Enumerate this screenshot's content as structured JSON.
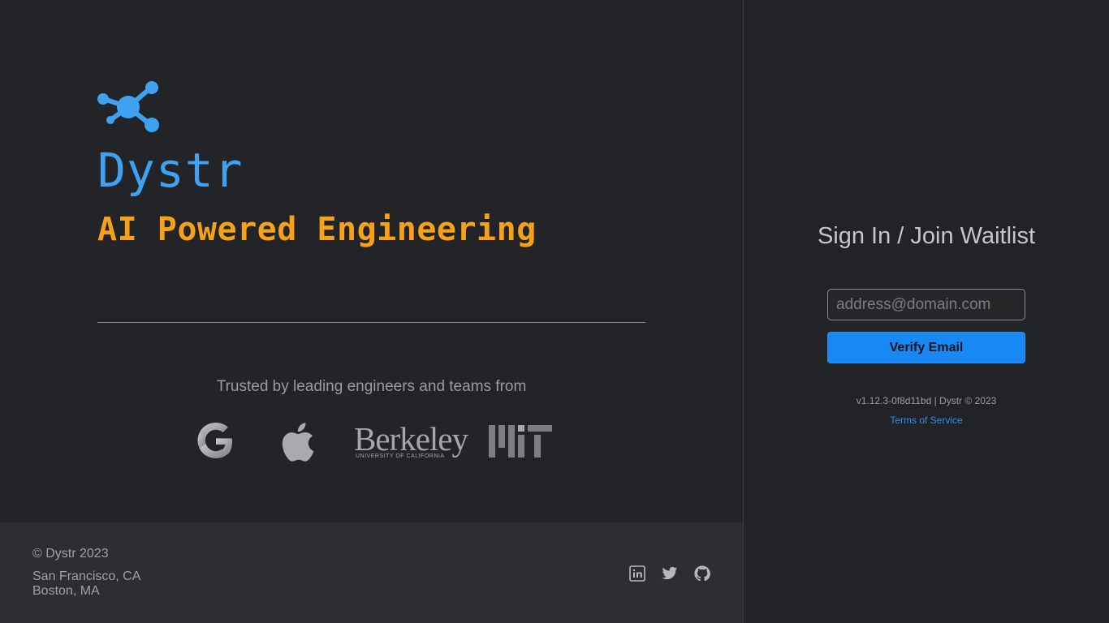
{
  "brand": {
    "name": "Dystr",
    "tagline": "AI Powered Engineering",
    "logo_icon": "network-nodes-icon",
    "name_color": "#3ea2f0",
    "tagline_color": "#f5a21a"
  },
  "trusted": {
    "text": "Trusted by leading engineers and teams from",
    "logos": [
      {
        "name": "google-logo",
        "label": "Google"
      },
      {
        "name": "apple-logo",
        "label": "Apple"
      },
      {
        "name": "berkeley-logo",
        "label": "Berkeley",
        "sublabel": "UNIVERSITY OF CALIFORNIA"
      },
      {
        "name": "mit-logo",
        "label": "MIT"
      }
    ]
  },
  "footer": {
    "copyright": "© Dystr 2023",
    "address_line1": "San Francisco, CA",
    "address_line2": "Boston, MA",
    "social": [
      {
        "name": "linkedin-icon"
      },
      {
        "name": "twitter-icon"
      },
      {
        "name": "github-icon"
      }
    ]
  },
  "signin": {
    "title": "Sign In / Join Waitlist",
    "email_placeholder": "address@domain.com",
    "email_value": "",
    "verify_label": "Verify Email",
    "version": "v1.12.3-0f8d11bd | Dystr © 2023",
    "tos_label": "Terms of Service",
    "accent_color": "#1888f5"
  }
}
